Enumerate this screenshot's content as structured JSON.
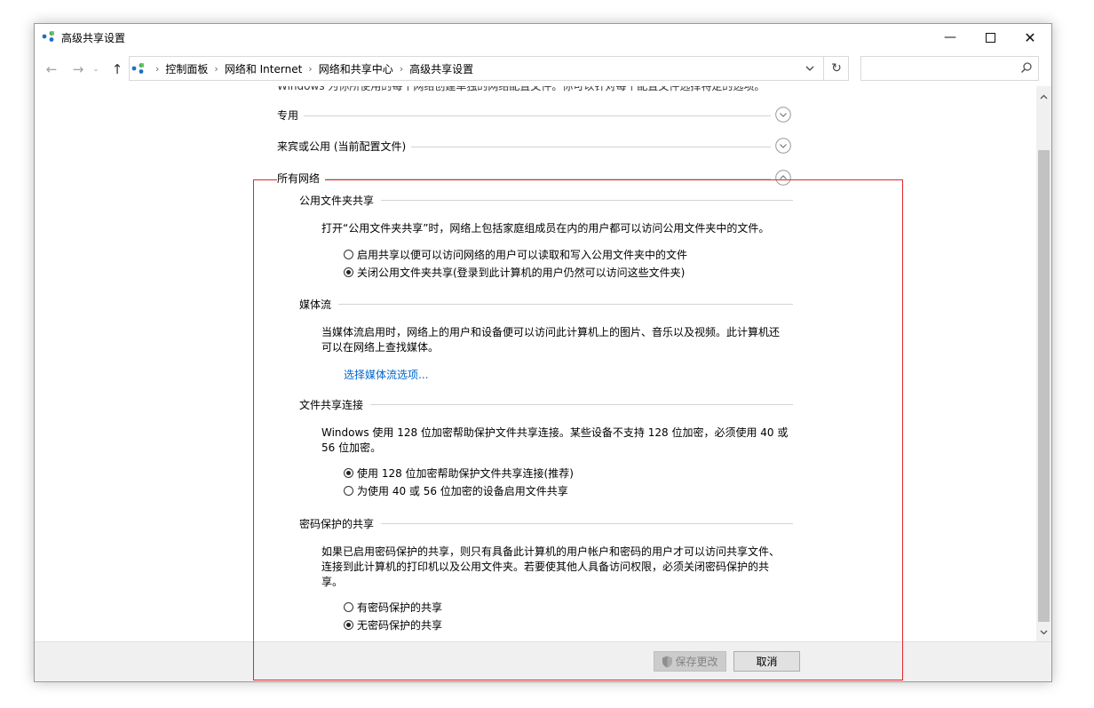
{
  "window": {
    "title": "高级共享设置",
    "minimize_icon": "minimize-icon",
    "maximize_icon": "maximize-icon",
    "close_icon": "close-icon"
  },
  "nav": {
    "back_icon": "arrow-left-icon",
    "forward_icon": "arrow-right-icon",
    "recent_icon": "chevron-down-icon",
    "up_icon": "arrow-up-icon"
  },
  "breadcrumbs": [
    "控制面板",
    "网络和 Internet",
    "网络和共享中心",
    "高级共享设置"
  ],
  "search": {
    "placeholder": ""
  },
  "content": {
    "cut_off_text": "Windows 为你所使用的每个网络创建单独的网络配置文件。你可以针对每个配置文件选择特定的选项。",
    "profiles": [
      {
        "label": "专用",
        "state": "collapsed"
      },
      {
        "label": "来宾或公用 (当前配置文件)",
        "state": "collapsed"
      },
      {
        "label": "所有网络",
        "state": "expanded"
      }
    ],
    "public_folder": {
      "heading": "公用文件夹共享",
      "description": "打开“公用文件夹共享”时，网络上包括家庭组成员在内的用户都可以访问公用文件夹中的文件。",
      "options": [
        {
          "label": "启用共享以便可以访问网络的用户可以读取和写入公用文件夹中的文件",
          "selected": false
        },
        {
          "label": "关闭公用文件夹共享(登录到此计算机的用户仍然可以访问这些文件夹)",
          "selected": true
        }
      ]
    },
    "media": {
      "heading": "媒体流",
      "description_line1": "当媒体流启用时，网络上的用户和设备便可以访问此计算机上的图片、音乐以及视频。此计算机还",
      "description_line2": "可以在网络上查找媒体。",
      "link": "选择媒体流选项..."
    },
    "file_sharing": {
      "heading": "文件共享连接",
      "description_line1": "Windows 使用 128 位加密帮助保护文件共享连接。某些设备不支持 128 位加密，必须使用 40 或",
      "description_line2": "56 位加密。",
      "options": [
        {
          "label": "使用 128 位加密帮助保护文件共享连接(推荐)",
          "selected": true
        },
        {
          "label": "为使用 40 或 56 位加密的设备启用文件共享",
          "selected": false
        }
      ]
    },
    "password": {
      "heading": "密码保护的共享",
      "description_line1": "如果已启用密码保护的共享，则只有具备此计算机的用户帐户和密码的用户才可以访问共享文件、",
      "description_line2": "连接到此计算机的打印机以及公用文件夹。若要使其他人具备访问权限，必须关闭密码保护的共",
      "description_line3": "享。",
      "options": [
        {
          "label": "有密码保护的共享",
          "selected": false
        },
        {
          "label": "无密码保护的共享",
          "selected": true
        }
      ]
    }
  },
  "footer": {
    "save_label": "保存更改",
    "save_icon": "shield-icon",
    "cancel_label": "取消"
  },
  "annotation": {
    "color": "#e0252c"
  }
}
